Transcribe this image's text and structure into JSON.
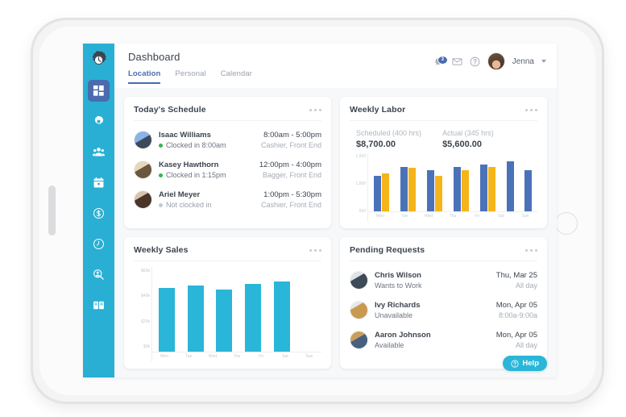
{
  "app": {
    "logo_icon": "gear-clock-logo",
    "page_title": "Dashboard",
    "accent_cyan": "#29afd4",
    "accent_blue": "#4a6bae",
    "accent_gold": "#f5b51a",
    "accent_teal": "#29b6d8"
  },
  "sidebar": {
    "items": [
      {
        "icon": "dashboard-grid-icon",
        "label": "Dashboard",
        "active": true
      },
      {
        "icon": "gear-icon",
        "label": "Settings",
        "active": false
      },
      {
        "icon": "people-icon",
        "label": "Employees",
        "active": false
      },
      {
        "icon": "calendar-icon",
        "label": "Schedule",
        "active": false
      },
      {
        "icon": "dollar-circle-icon",
        "label": "Payroll",
        "active": false
      },
      {
        "icon": "clock-icon",
        "label": "Time Clock",
        "active": false
      },
      {
        "icon": "magnifier-person-icon",
        "label": "Hiring",
        "active": false
      },
      {
        "icon": "book-icon",
        "label": "Reports",
        "active": false
      }
    ]
  },
  "header": {
    "tabs": [
      {
        "label": "Location",
        "active": true
      },
      {
        "label": "Personal",
        "active": false
      },
      {
        "label": "Calendar",
        "active": false
      }
    ],
    "icons": [
      {
        "name": "messages-icon",
        "badge": "3"
      },
      {
        "name": "mail-icon",
        "badge": ""
      },
      {
        "name": "help-circle-icon",
        "badge": ""
      }
    ],
    "user_name": "Jenna",
    "avatar": "user-avatar",
    "caret": "chevron-down-icon"
  },
  "cards": {
    "schedule": {
      "title": "Today's Schedule",
      "menu": "more-options-icon",
      "rows": [
        {
          "name": "Isaac Williams",
          "status": "Clocked in 8:00am",
          "clocked": true,
          "time": "8:00am - 5:00pm",
          "role": "Cashier, Front End"
        },
        {
          "name": "Kasey Hawthorn",
          "status": "Clocked in 1:15pm",
          "clocked": true,
          "time": "12:00pm - 4:00pm",
          "role": "Bagger, Front End"
        },
        {
          "name": "Ariel Meyer",
          "status": "Not clocked in",
          "clocked": false,
          "time": "1:00pm - 5:30pm",
          "role": "Cashier, Front End"
        }
      ]
    },
    "labor": {
      "title": "Weekly Labor",
      "menu": "more-options-icon",
      "stats": [
        {
          "label": "Scheduled (400 hrs)",
          "value": "$8,700.00"
        },
        {
          "label": "Actual (345 hrs)",
          "value": "$5,600.00"
        }
      ]
    },
    "sales": {
      "title": "Weekly Sales",
      "menu": "more-options-icon"
    },
    "requests": {
      "title": "Pending Requests",
      "menu": "more-options-icon",
      "rows": [
        {
          "name": "Chris Wilson",
          "type": "Wants to Work",
          "date": "Thu, Mar 25",
          "time": "All day"
        },
        {
          "name": "Ivy Richards",
          "type": "Unavailable",
          "date": "Mon, Apr 05",
          "time": "8:00a-9:00a"
        },
        {
          "name": "Aaron Johnson",
          "type": "Available",
          "date": "Mon, Apr 05",
          "time": "All day"
        }
      ]
    }
  },
  "help": {
    "label": "Help",
    "icon": "question-circle-icon"
  },
  "chart_data": [
    {
      "id": "weekly-labor",
      "type": "bar",
      "title": "Weekly Labor",
      "xlabel": "",
      "ylabel": "",
      "categories": [
        "Mon",
        "Tue",
        "Wed",
        "Thu",
        "Fri",
        "Sat",
        "Sun"
      ],
      "ylim": [
        0,
        1600
      ],
      "yticks": [
        "1,500",
        "1,000",
        "500"
      ],
      "grid": false,
      "legend": [
        "Scheduled",
        "Actual"
      ],
      "series": [
        {
          "name": "Scheduled",
          "color": "#4a72b8",
          "values": [
            1000,
            1250,
            1150,
            1230,
            1300,
            1400,
            1150
          ]
        },
        {
          "name": "Actual",
          "color": "#f5b51a",
          "values": [
            1060,
            1220,
            1000,
            1150,
            1250,
            null,
            null
          ]
        }
      ]
    },
    {
      "id": "weekly-sales",
      "type": "bar",
      "title": "Weekly Sales",
      "xlabel": "",
      "ylabel": "",
      "categories": [
        "Mon",
        "Tue",
        "Wed",
        "Thu",
        "Fri",
        "Sat",
        "Sun"
      ],
      "ylim": [
        0,
        60
      ],
      "yticks": [
        "$60k",
        "$40k",
        "$20k",
        "$0k"
      ],
      "grid": false,
      "series": [
        {
          "name": "Sales",
          "color": "#29b6d8",
          "values": [
            45,
            47,
            44,
            48,
            50,
            0,
            0
          ]
        }
      ]
    }
  ]
}
